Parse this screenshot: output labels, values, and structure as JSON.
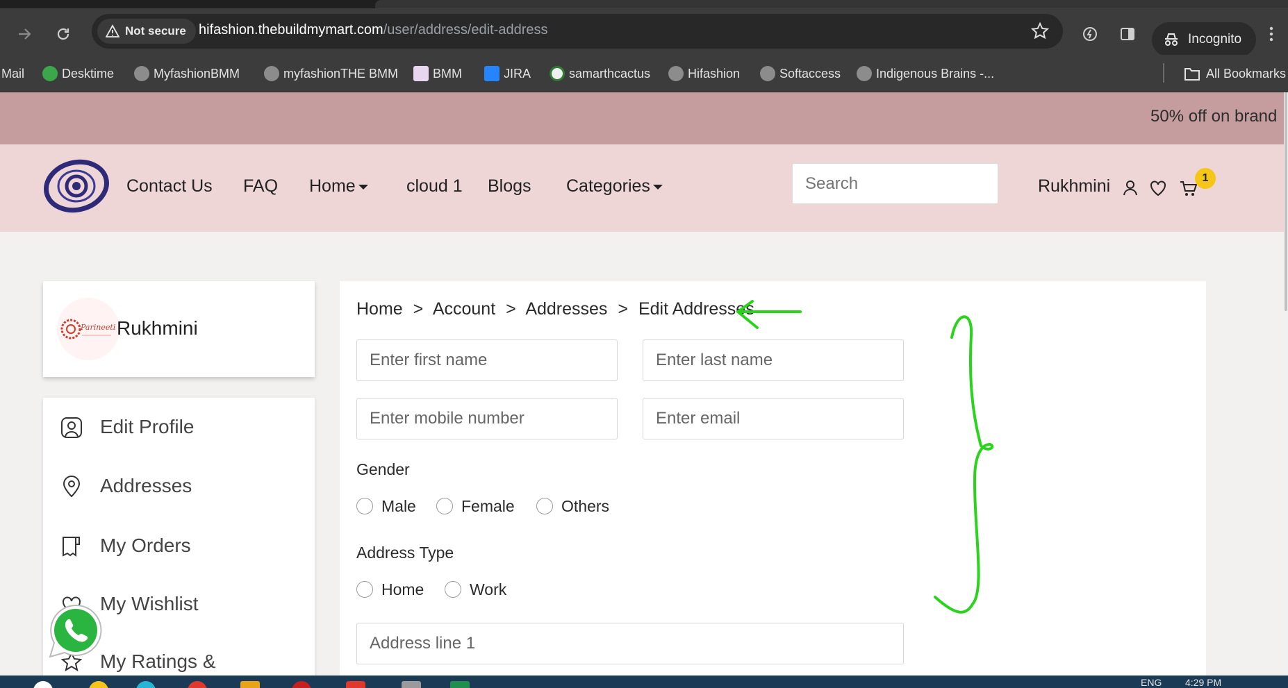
{
  "browser": {
    "security_label": "Not secure",
    "url_host": "hifashion.thebuildmymart.com",
    "url_path": "/user/address/edit-address",
    "incognito_label": "Incognito",
    "bookmarks": [
      "Mail",
      "Desktime",
      "MyfashionBMM",
      "myfashionTHE BMM",
      "BMM",
      "JIRA",
      "samarthcactus",
      "Hifashion",
      "Softaccess",
      "Indigenous Brains -...",
      "All Bookmarks"
    ]
  },
  "promo": {
    "text": "50% off on brand"
  },
  "nav": {
    "links": [
      "Contact Us",
      "FAQ",
      "Home",
      "cloud 1",
      "Blogs",
      "Categories"
    ],
    "search_placeholder": "Search",
    "user_name": "Rukhmini",
    "cart_count": "1"
  },
  "profile": {
    "avatar_text": "Parineeti",
    "name": "Rukhmini"
  },
  "sidebar": {
    "items": [
      "Edit Profile",
      "Addresses",
      "My Orders",
      "My Wishlist",
      "My Ratings &"
    ]
  },
  "breadcrumb": [
    "Home",
    ">",
    "Account",
    ">",
    "Addresses",
    ">",
    "Edit Addresses"
  ],
  "form": {
    "first_name_placeholder": "Enter first name",
    "last_name_placeholder": "Enter last name",
    "mobile_placeholder": "Enter mobile number",
    "email_placeholder": "Enter email",
    "gender_label": "Gender",
    "gender_options": [
      "Male",
      "Female",
      "Others"
    ],
    "address_type_label": "Address Type",
    "address_type_options": [
      "Home",
      "Work"
    ],
    "address_line1_placeholder": "Address line 1"
  },
  "taskbar": {
    "lang": "ENG",
    "time": "4:29 PM"
  },
  "colors": {
    "promo_bg": "#c69d9e",
    "nav_bg": "#eed6d7",
    "page_bg": "#f2f1f0",
    "badge": "#f5c518",
    "annotation": "#2bd41c"
  }
}
